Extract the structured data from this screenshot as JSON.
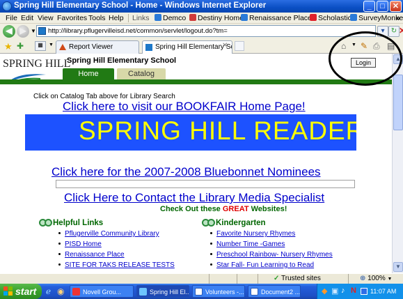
{
  "window": {
    "title": "Spring Hill Elementary School - Home - Windows Internet Explorer"
  },
  "menubar": {
    "items": [
      "File",
      "Edit",
      "View",
      "Favorites",
      "Tools",
      "Help"
    ],
    "links_label": "Links",
    "links": [
      "Demco",
      "Destiny Home",
      "Renaissance Place",
      "Scholastic",
      "SurveyMonkey"
    ],
    "overflow": "»"
  },
  "address": {
    "url": "http://library.pflugervilleisd.net/common/servlet/logout.do?tm="
  },
  "tabs": {
    "items": [
      "Report Viewer",
      "Spring Hill Elementary Sch..."
    ]
  },
  "site": {
    "logo_text": "SPRING HILL",
    "school_name": "Spring Hill Elementary School",
    "login_label": "Login",
    "nav": {
      "home": "Home",
      "catalog": "Catalog"
    },
    "catalog_note": "Click on Catalog Tab above for Library Search",
    "bookfair_link": "Click here to visit our BOOKFAIR Home Page!",
    "readers_banner": "SPRING HILL READERS R",
    "bluebonnet_link": "Click here for the 2007-2008 Bluebonnet Nominees",
    "contact_link": "Click Here to Contact the Library Media Specialist",
    "websites_prefix": "Check Out these ",
    "websites_great": "GREAT",
    "websites_suffix": " Websites!",
    "helpful": {
      "heading": "Helpful Links",
      "items": [
        "Pflugerville Community Library",
        "PISD Home",
        "Renaissance Place",
        "SITE FOR TAKS RELEASE TESTS"
      ]
    },
    "kinder": {
      "heading": "Kindergarten",
      "items": [
        "Favorite Nursery Rhymes",
        "Number Time -Games",
        "Preschool Rainbow- Nursery Rhymes",
        "Star Fall- Fun Learning to Read"
      ]
    }
  },
  "statusbar": {
    "zone": "Trusted sites",
    "zoom": "100%"
  },
  "taskbar": {
    "start_label": "start",
    "tasks": [
      "Novell Grou...",
      "Spring Hill El...",
      "Volunteers -...",
      "Document2 ..."
    ],
    "clock": "11:07 AM"
  },
  "colors": {
    "green": "#217a14",
    "banner_blue": "#1d52ff",
    "banner_yellow": "#ffff00",
    "link_blue": "#0000cc"
  }
}
